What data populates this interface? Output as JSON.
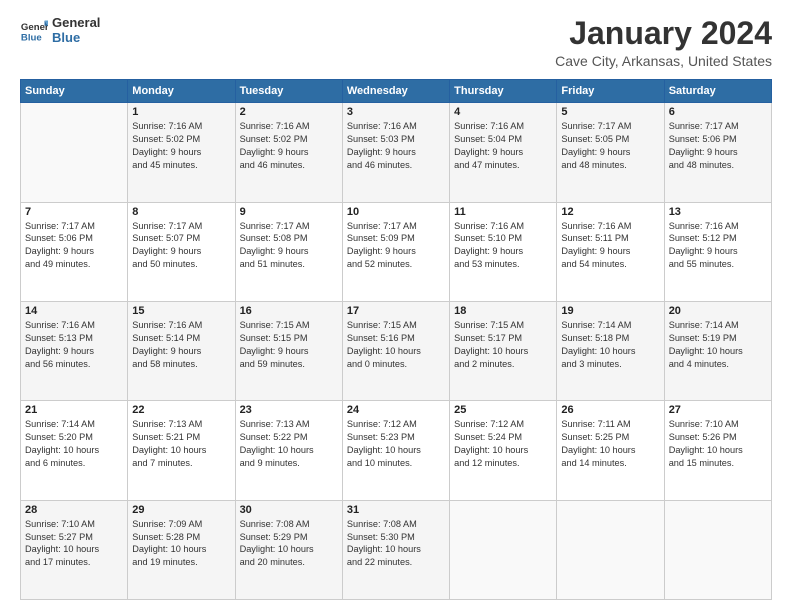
{
  "logo": {
    "line1": "General",
    "line2": "Blue"
  },
  "header": {
    "month": "January 2024",
    "location": "Cave City, Arkansas, United States"
  },
  "weekdays": [
    "Sunday",
    "Monday",
    "Tuesday",
    "Wednesday",
    "Thursday",
    "Friday",
    "Saturday"
  ],
  "weeks": [
    [
      {
        "day": "",
        "info": ""
      },
      {
        "day": "1",
        "info": "Sunrise: 7:16 AM\nSunset: 5:02 PM\nDaylight: 9 hours\nand 45 minutes."
      },
      {
        "day": "2",
        "info": "Sunrise: 7:16 AM\nSunset: 5:02 PM\nDaylight: 9 hours\nand 46 minutes."
      },
      {
        "day": "3",
        "info": "Sunrise: 7:16 AM\nSunset: 5:03 PM\nDaylight: 9 hours\nand 46 minutes."
      },
      {
        "day": "4",
        "info": "Sunrise: 7:16 AM\nSunset: 5:04 PM\nDaylight: 9 hours\nand 47 minutes."
      },
      {
        "day": "5",
        "info": "Sunrise: 7:17 AM\nSunset: 5:05 PM\nDaylight: 9 hours\nand 48 minutes."
      },
      {
        "day": "6",
        "info": "Sunrise: 7:17 AM\nSunset: 5:06 PM\nDaylight: 9 hours\nand 48 minutes."
      }
    ],
    [
      {
        "day": "7",
        "info": "Sunrise: 7:17 AM\nSunset: 5:06 PM\nDaylight: 9 hours\nand 49 minutes."
      },
      {
        "day": "8",
        "info": "Sunrise: 7:17 AM\nSunset: 5:07 PM\nDaylight: 9 hours\nand 50 minutes."
      },
      {
        "day": "9",
        "info": "Sunrise: 7:17 AM\nSunset: 5:08 PM\nDaylight: 9 hours\nand 51 minutes."
      },
      {
        "day": "10",
        "info": "Sunrise: 7:17 AM\nSunset: 5:09 PM\nDaylight: 9 hours\nand 52 minutes."
      },
      {
        "day": "11",
        "info": "Sunrise: 7:16 AM\nSunset: 5:10 PM\nDaylight: 9 hours\nand 53 minutes."
      },
      {
        "day": "12",
        "info": "Sunrise: 7:16 AM\nSunset: 5:11 PM\nDaylight: 9 hours\nand 54 minutes."
      },
      {
        "day": "13",
        "info": "Sunrise: 7:16 AM\nSunset: 5:12 PM\nDaylight: 9 hours\nand 55 minutes."
      }
    ],
    [
      {
        "day": "14",
        "info": "Sunrise: 7:16 AM\nSunset: 5:13 PM\nDaylight: 9 hours\nand 56 minutes."
      },
      {
        "day": "15",
        "info": "Sunrise: 7:16 AM\nSunset: 5:14 PM\nDaylight: 9 hours\nand 58 minutes."
      },
      {
        "day": "16",
        "info": "Sunrise: 7:15 AM\nSunset: 5:15 PM\nDaylight: 9 hours\nand 59 minutes."
      },
      {
        "day": "17",
        "info": "Sunrise: 7:15 AM\nSunset: 5:16 PM\nDaylight: 10 hours\nand 0 minutes."
      },
      {
        "day": "18",
        "info": "Sunrise: 7:15 AM\nSunset: 5:17 PM\nDaylight: 10 hours\nand 2 minutes."
      },
      {
        "day": "19",
        "info": "Sunrise: 7:14 AM\nSunset: 5:18 PM\nDaylight: 10 hours\nand 3 minutes."
      },
      {
        "day": "20",
        "info": "Sunrise: 7:14 AM\nSunset: 5:19 PM\nDaylight: 10 hours\nand 4 minutes."
      }
    ],
    [
      {
        "day": "21",
        "info": "Sunrise: 7:14 AM\nSunset: 5:20 PM\nDaylight: 10 hours\nand 6 minutes."
      },
      {
        "day": "22",
        "info": "Sunrise: 7:13 AM\nSunset: 5:21 PM\nDaylight: 10 hours\nand 7 minutes."
      },
      {
        "day": "23",
        "info": "Sunrise: 7:13 AM\nSunset: 5:22 PM\nDaylight: 10 hours\nand 9 minutes."
      },
      {
        "day": "24",
        "info": "Sunrise: 7:12 AM\nSunset: 5:23 PM\nDaylight: 10 hours\nand 10 minutes."
      },
      {
        "day": "25",
        "info": "Sunrise: 7:12 AM\nSunset: 5:24 PM\nDaylight: 10 hours\nand 12 minutes."
      },
      {
        "day": "26",
        "info": "Sunrise: 7:11 AM\nSunset: 5:25 PM\nDaylight: 10 hours\nand 14 minutes."
      },
      {
        "day": "27",
        "info": "Sunrise: 7:10 AM\nSunset: 5:26 PM\nDaylight: 10 hours\nand 15 minutes."
      }
    ],
    [
      {
        "day": "28",
        "info": "Sunrise: 7:10 AM\nSunset: 5:27 PM\nDaylight: 10 hours\nand 17 minutes."
      },
      {
        "day": "29",
        "info": "Sunrise: 7:09 AM\nSunset: 5:28 PM\nDaylight: 10 hours\nand 19 minutes."
      },
      {
        "day": "30",
        "info": "Sunrise: 7:08 AM\nSunset: 5:29 PM\nDaylight: 10 hours\nand 20 minutes."
      },
      {
        "day": "31",
        "info": "Sunrise: 7:08 AM\nSunset: 5:30 PM\nDaylight: 10 hours\nand 22 minutes."
      },
      {
        "day": "",
        "info": ""
      },
      {
        "day": "",
        "info": ""
      },
      {
        "day": "",
        "info": ""
      }
    ]
  ]
}
